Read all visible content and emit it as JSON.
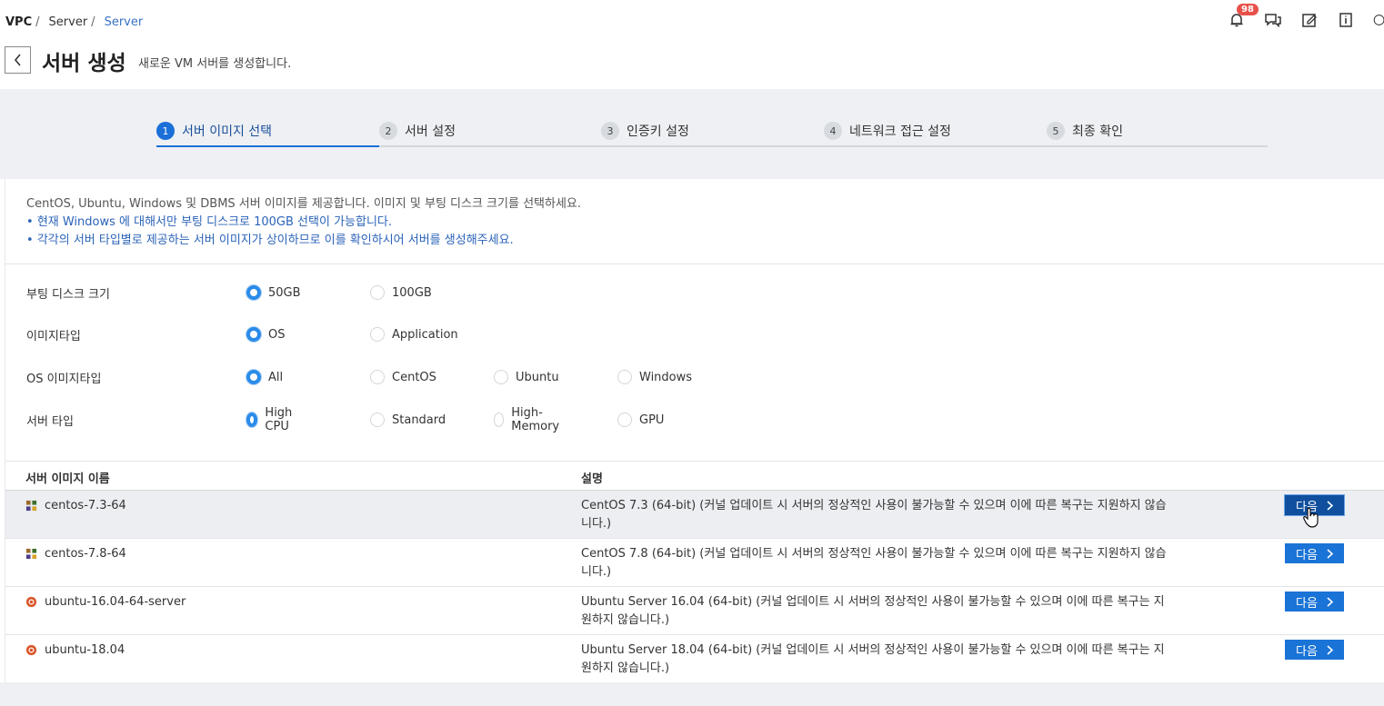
{
  "breadcrumb": {
    "root": "VPC",
    "sep1": "/",
    "level2": "Server",
    "sep2": "/",
    "current": "Server"
  },
  "header": {
    "title": "서버 생성",
    "subtitle": "새로운 VM 서버를 생성합니다.",
    "notification_count": "98"
  },
  "steps": [
    {
      "num": "1",
      "label": "서버 이미지 선택",
      "active": true
    },
    {
      "num": "2",
      "label": "서버 설정"
    },
    {
      "num": "3",
      "label": "인증키 설정"
    },
    {
      "num": "4",
      "label": "네트워크 접근 설정"
    },
    {
      "num": "5",
      "label": "최종 확인"
    }
  ],
  "info": {
    "lead": "CentOS, Ubuntu, Windows 및 DBMS 서버 이미지를 제공합니다. 이미지 및 부팅 디스크 크기를 선택하세요.",
    "bullets": [
      "현재 Windows 에 대해서만 부팅 디스크로 100GB 선택이 가능합니다.",
      "각각의 서버 타입별로 제공하는 서버 이미지가 상이하므로 이를 확인하시어 서버를 생성해주세요."
    ]
  },
  "options": [
    {
      "label": "부팅 디스크 크기",
      "choices": [
        "50GB",
        "100GB"
      ],
      "selected": "50GB"
    },
    {
      "label": "이미지타입",
      "choices": [
        "OS",
        "Application"
      ],
      "selected": "OS"
    },
    {
      "label": "OS 이미지타입",
      "choices": [
        "All",
        "CentOS",
        "Ubuntu",
        "Windows"
      ],
      "selected": "All"
    },
    {
      "label": "서버 타입",
      "choices": [
        "High CPU",
        "Standard",
        "High-Memory",
        "GPU"
      ],
      "selected": "High CPU"
    }
  ],
  "table": {
    "headers": {
      "name": "서버 이미지 이름",
      "desc": "설명"
    },
    "next_label": "다음",
    "rows": [
      {
        "name": "centos-7.3-64",
        "os": "centos",
        "desc": "CentOS 7.3 (64-bit) (커널 업데이트 시 서버의 정상적인 사용이 불가능할 수 있으며 이에 따른 복구는 지원하지 않습니다.)"
      },
      {
        "name": "centos-7.8-64",
        "os": "centos",
        "desc": "CentOS 7.8 (64-bit) (커널 업데이트 시 서버의 정상적인 사용이 불가능할 수 있으며 이에 따른 복구는 지원하지 않습니다.)"
      },
      {
        "name": "ubuntu-16.04-64-server",
        "os": "ubuntu",
        "desc": "Ubuntu Server 16.04 (64-bit) (커널 업데이트 시 서버의 정상적인 사용이 불가능할 수 있으며 이에 따른 복구는 지원하지 않습니다.)"
      },
      {
        "name": "ubuntu-18.04",
        "os": "ubuntu",
        "desc": "Ubuntu Server 18.04 (64-bit) (커널 업데이트 시 서버의 정상적인 사용이 불가능할 수 있으며 이에 따른 복구는 지원하지 않습니다.)"
      }
    ]
  },
  "colors": {
    "accent": "#1a73d6",
    "radio": "#2b8be8",
    "badge": "#e8514a",
    "bullet_text": "#2b63b8"
  },
  "icons": [
    "bell-icon",
    "chat-icon",
    "edit-icon",
    "info-icon",
    "user-icon",
    "chevron-left-icon",
    "chevron-right-icon",
    "centos-icon",
    "ubuntu-icon",
    "pointer-cursor-icon"
  ]
}
